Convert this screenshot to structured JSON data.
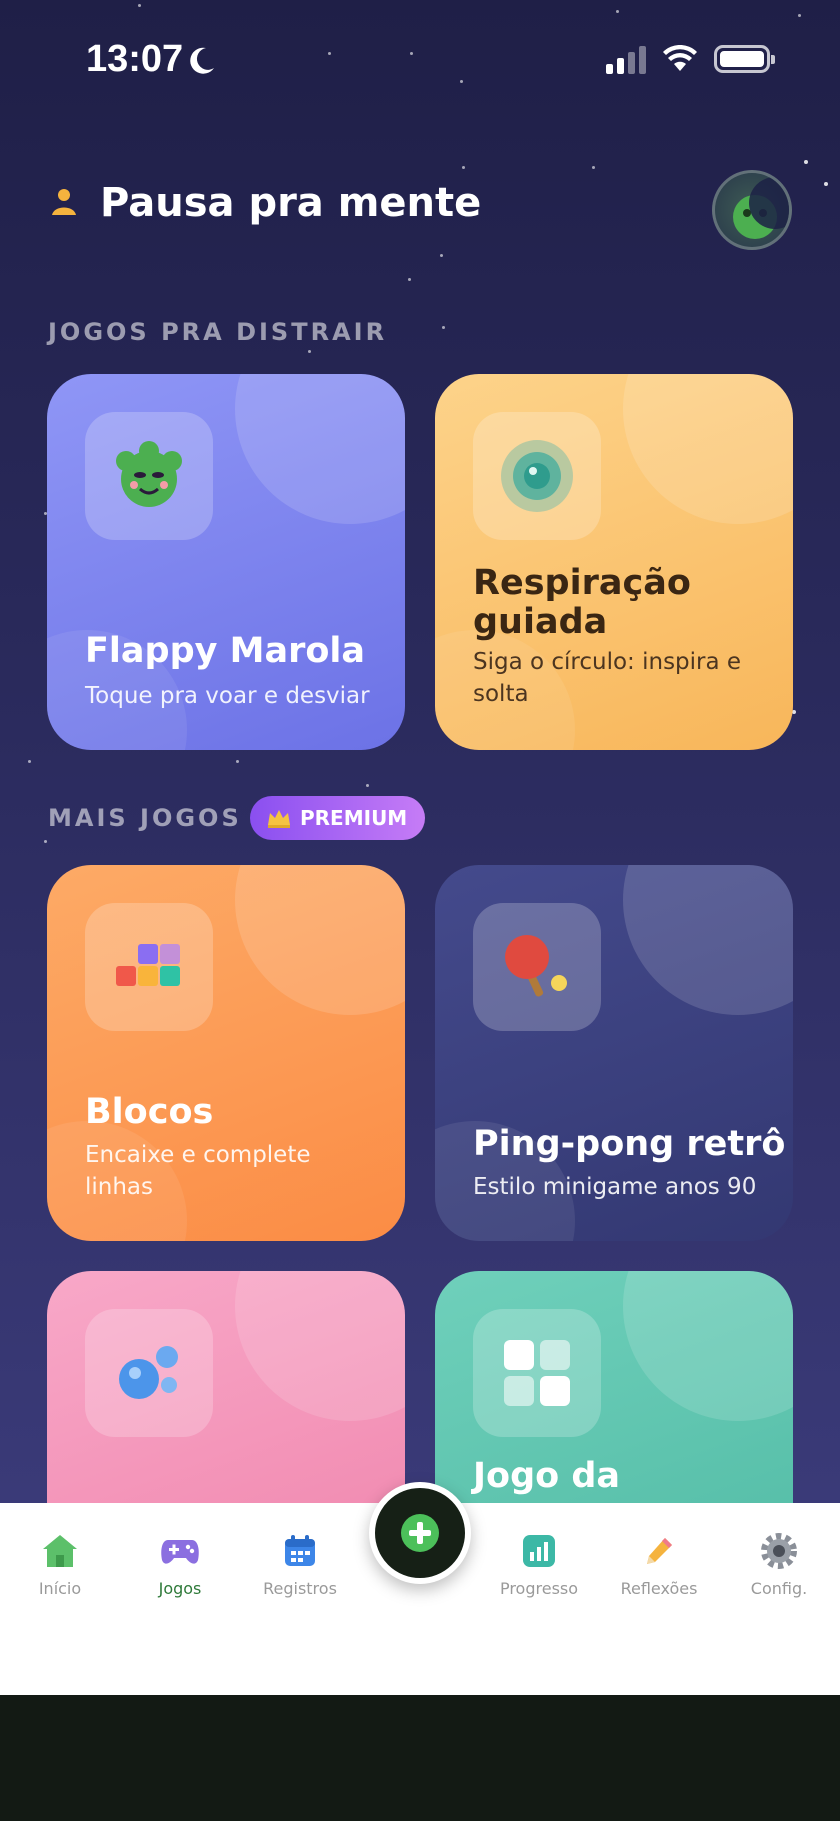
{
  "status_bar": {
    "time": "13:07"
  },
  "header": {
    "title": "Pausa pra mente"
  },
  "sections": {
    "distract_label": "JOGOS PRA DISTRAIR",
    "more_label": "MAIS JOGOS",
    "premium_badge": "PREMIUM"
  },
  "cards": [
    {
      "title": "Flappy Marola",
      "subtitle": "Toque pra voar e desviar",
      "icon": "green-monster-icon",
      "color": "#7b82ef"
    },
    {
      "title": "Respiração guiada",
      "subtitle": "Siga o círculo: inspira e solta",
      "icon": "breathing-circle-icon",
      "color": "#fcc56a"
    },
    {
      "title": "Blocos",
      "subtitle": "Encaixe e complete linhas",
      "icon": "blocks-icon",
      "color": "#fd9a4f"
    },
    {
      "title": "Ping-pong retrô",
      "subtitle": "Estilo minigame anos 90",
      "icon": "ping-pong-icon",
      "color": "#3b4180"
    },
    {
      "title": "",
      "subtitle": "",
      "icon": "bubbles-icon",
      "color": "#f592b8"
    },
    {
      "title": "Jogo da",
      "subtitle": "",
      "icon": "grid-icon",
      "color": "#5fc6b0"
    }
  ],
  "nav": {
    "items": [
      {
        "label": "Início",
        "icon": "home-icon"
      },
      {
        "label": "Jogos",
        "icon": "gamepad-icon"
      },
      {
        "label": "Registros",
        "icon": "calendar-icon"
      },
      {
        "label": "Progresso",
        "icon": "chart-icon"
      },
      {
        "label": "Reflexões",
        "icon": "pencil-icon"
      },
      {
        "label": "Config.",
        "icon": "gear-icon"
      }
    ],
    "active": "Jogos",
    "fab_icon": "plus-icon"
  },
  "colors": {
    "accent_green": "#2f7a3a",
    "premium": "#8a4ff0"
  }
}
